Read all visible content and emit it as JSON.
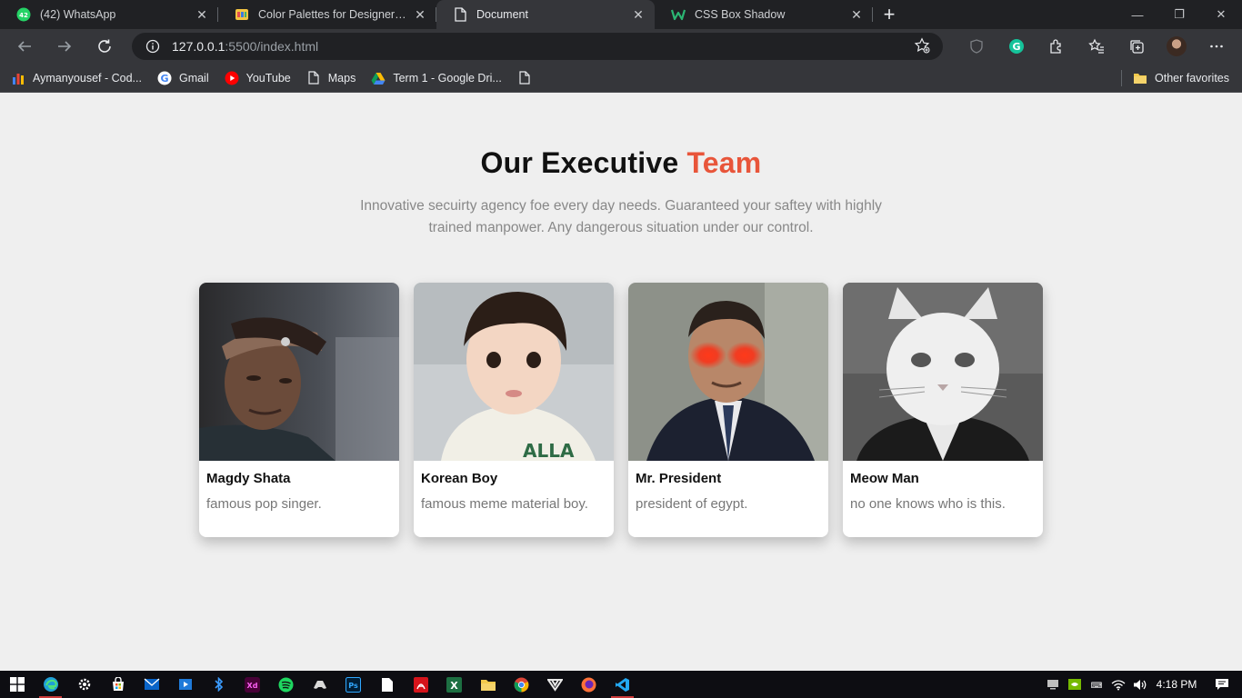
{
  "tabs": [
    {
      "title": "(42) WhatsApp",
      "icon": "whatsapp-icon",
      "active": false
    },
    {
      "title": "Color Palettes for Designers and",
      "icon": "palette-icon",
      "active": false
    },
    {
      "title": "Document",
      "icon": "document-icon",
      "active": true
    },
    {
      "title": "CSS Box Shadow",
      "icon": "w-icon",
      "active": false
    }
  ],
  "address": {
    "host": "127.0.0.1",
    "rest": ":5500/index.html"
  },
  "bookmarks": [
    {
      "label": "Aymanyousef - Cod...",
      "icon": "bar-chart-icon"
    },
    {
      "label": "Gmail",
      "icon": "google-icon"
    },
    {
      "label": "YouTube",
      "icon": "youtube-icon"
    },
    {
      "label": "Maps",
      "icon": "page-icon"
    },
    {
      "label": "Term 1 - Google Dri...",
      "icon": "drive-icon"
    },
    {
      "label": "",
      "icon": "page-icon"
    }
  ],
  "other_favorites": "Other favorites",
  "page": {
    "title_main": "Our Executive ",
    "title_accent": "Team",
    "subtitle": "Innovative secuirty agency foe every day needs. Guaranteed your saftey with highly trained manpower. Any dangerous situation under our control.",
    "accent_color": "#e8553a"
  },
  "team": [
    {
      "name": "Magdy Shata",
      "desc": "famous pop singer."
    },
    {
      "name": "Korean Boy",
      "desc": "famous meme material boy."
    },
    {
      "name": "Mr. President",
      "desc": "president of egypt."
    },
    {
      "name": "Meow Man",
      "desc": "no one knows who is this."
    }
  ],
  "taskbar": {
    "time": "4:18 PM"
  }
}
